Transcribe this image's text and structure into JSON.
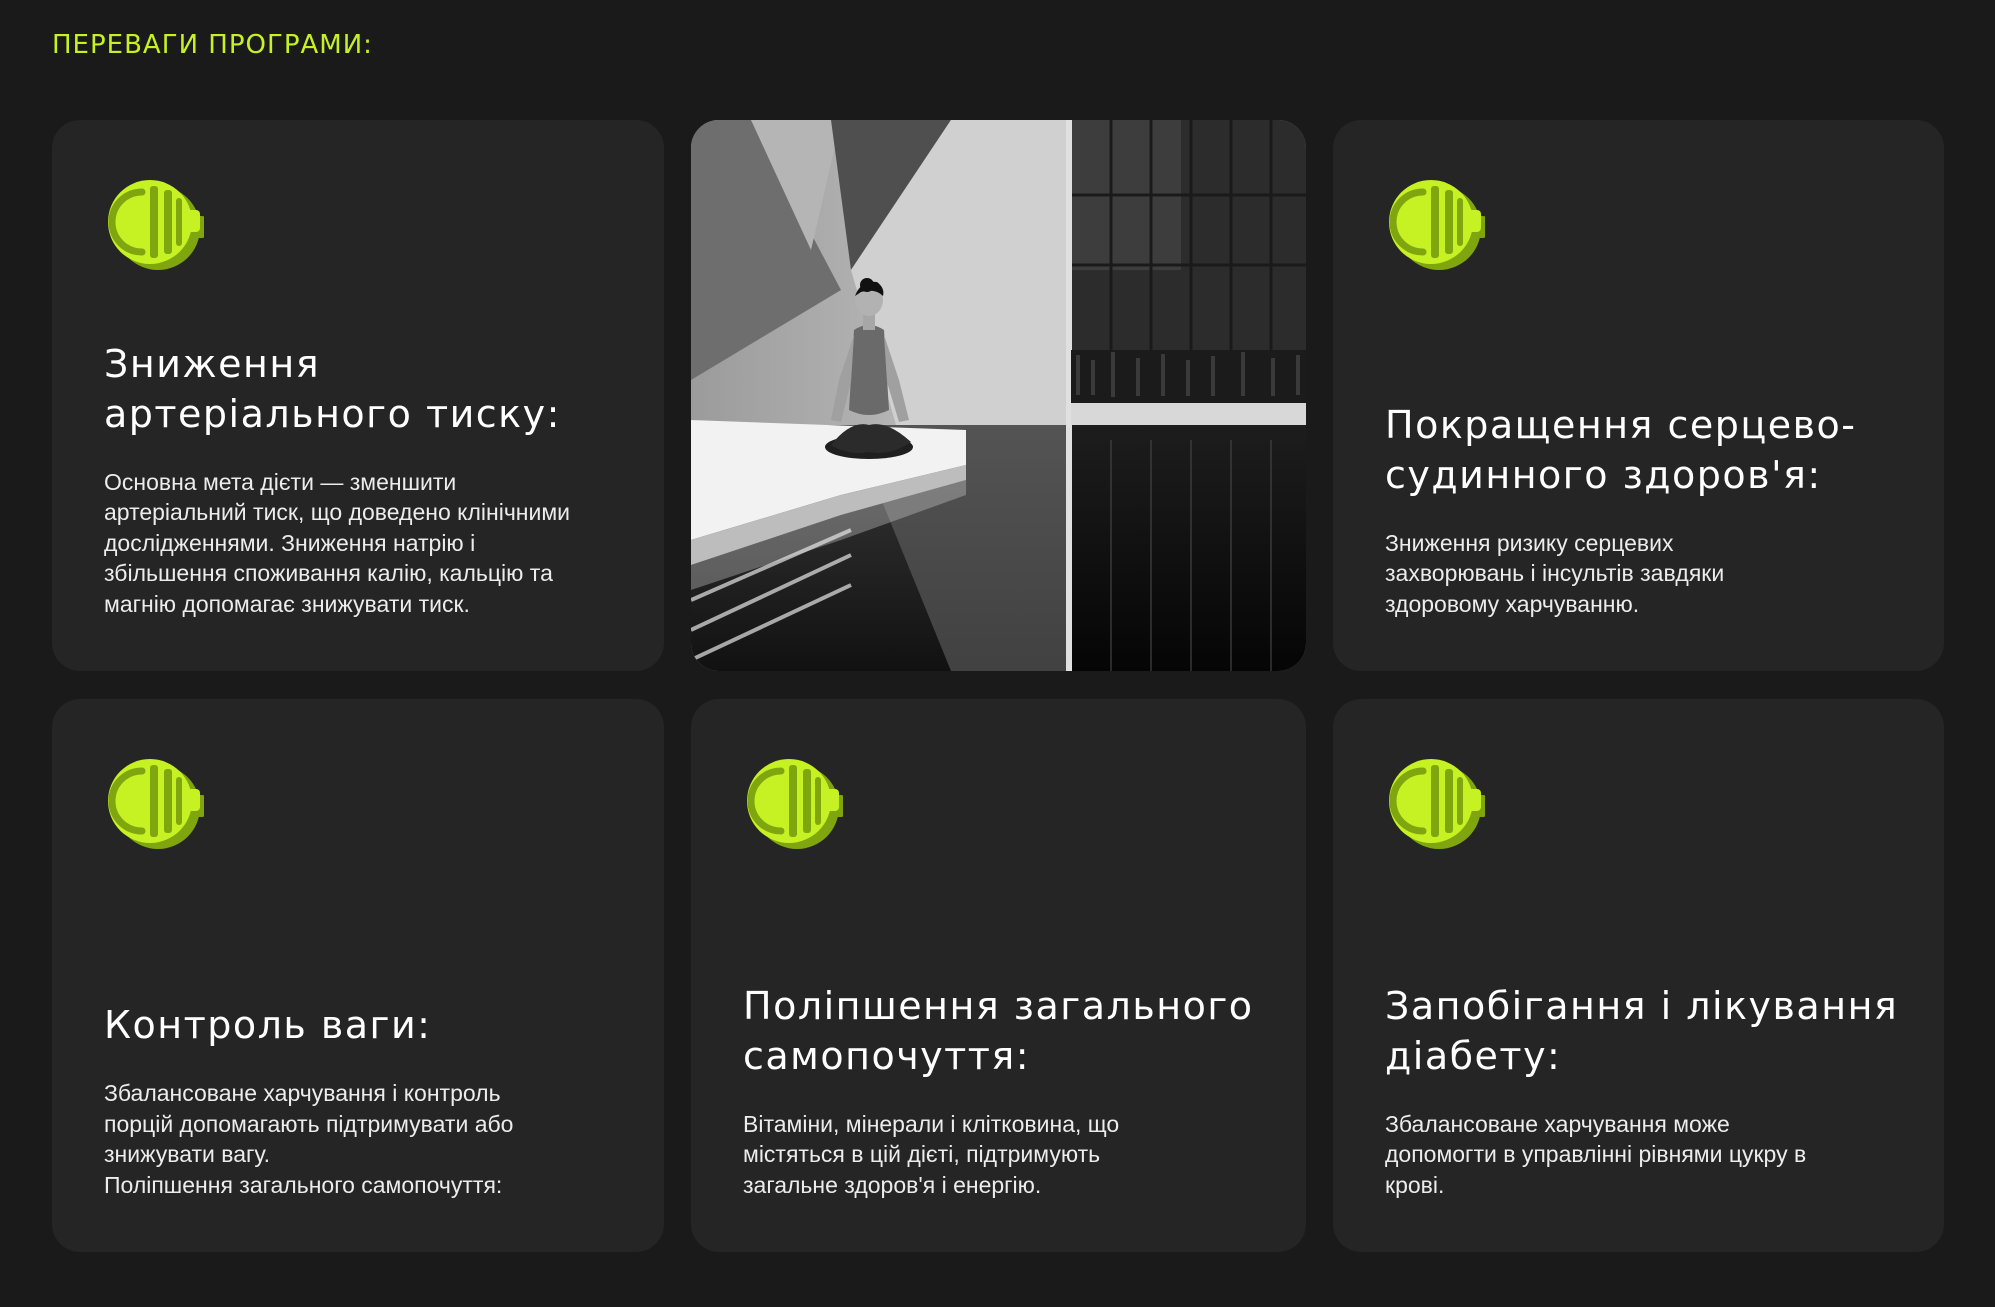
{
  "section": {
    "title": "ПЕРЕВАГИ ПРОГРАМИ:"
  },
  "icon_name": "dumbbell-plate-icon",
  "accent_color": "#c6f123",
  "cards": [
    {
      "title": "Зниження артеріального тиску:",
      "description": "Основна мета дієти — зменшити артеріальний тиск, що доведено клінічними дослідженнями. Зниження натрію і збільшення споживання калію, кальцію та магнію допомагає знижувати тиск."
    },
    {
      "title": "Покращення серцево-судинного здоров'я:",
      "description": "Зниження ризику серцевих захворювань і інсультів завдяки здоровому харчуванню."
    },
    {
      "title": "Контроль ваги:",
      "description": "Збалансоване харчування і контроль порцій допомагають підтримувати або знижувати вагу.",
      "description_extra": "Поліпшення загального самопочуття:"
    },
    {
      "title": "Поліпшення загального самопочуття:",
      "description": "Вітаміни, мінерали і клітковина, що містяться в цій дієті, підтримують загальне здоров'я і енергію."
    },
    {
      "title": "Запобігання і лікування діабету:",
      "description": "Збалансоване харчування може допомогти в управлінні рівнями цукру в крові."
    }
  ],
  "photo": {
    "subject": "woman-meditating-by-water-photo"
  }
}
